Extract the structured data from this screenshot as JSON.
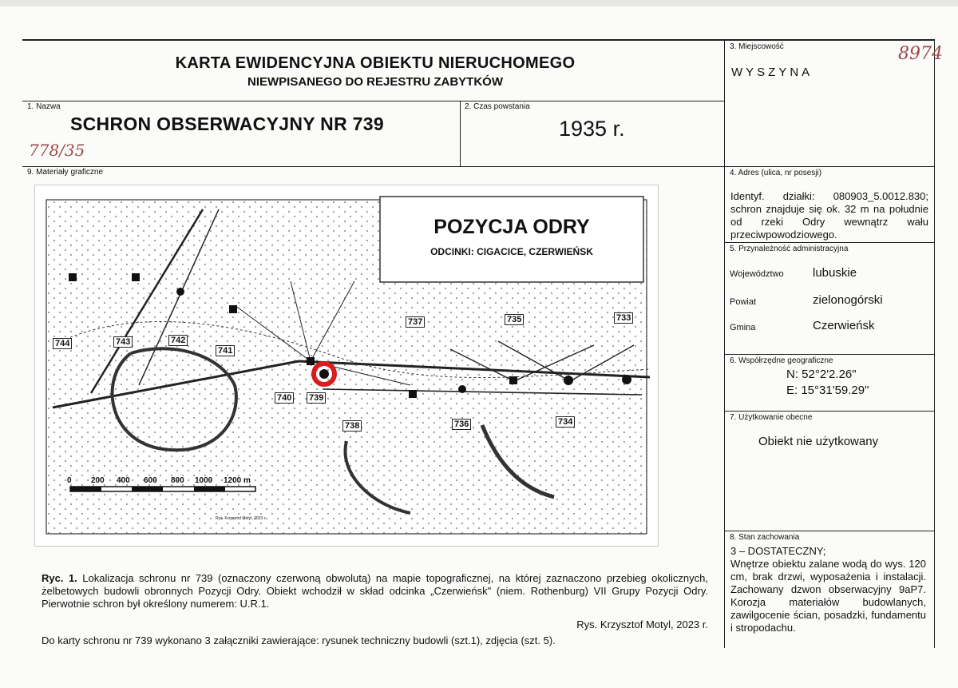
{
  "header": {
    "title_line1": "KARTA EWIDENCYJNA OBIEKTU NIERUCHOMEGO",
    "title_line2": "NIEWPISANEGO DO REJESTRU ZABYTKÓW"
  },
  "handwritten": {
    "top_right": "8974",
    "under_name": "778/35"
  },
  "fields": {
    "nazwa": {
      "label": "1. Nazwa",
      "value": "SCHRON OBSERWACYJNY NR 739"
    },
    "czas": {
      "label": "2. Czas powstania",
      "value": "1935 r."
    },
    "miejscowosc": {
      "label": "3. Miejscowość",
      "value": "WYSZYNA"
    },
    "adres": {
      "label": "4. Adres (ulica, nr posesji)",
      "value": "Identyf. działki: 080903_5.0012.830; schron znajduje się ok. 32 m na południe od rzeki Odry wewnątrz wału przeciwpowodziowego."
    },
    "przynaleznosc": {
      "label": "5. Przynależność administracyjna",
      "rows": [
        {
          "key": "Województwo",
          "value": "lubuskie"
        },
        {
          "key": "Powiat",
          "value": "zielonogórski"
        },
        {
          "key": "Gmina",
          "value": "Czerwieńsk"
        }
      ]
    },
    "wspolrzedne": {
      "label": "6. Współrzędne geograficzne",
      "n": "N: 52°2'2.26\"",
      "e": "E: 15°31'59.29\""
    },
    "uzytkowanie": {
      "label": "7. Użytkowanie obecne",
      "value": "Obiekt nie użytkowany"
    },
    "stan": {
      "label": "8. Stan zachowania",
      "value": "3 – DOSTATECZNY;",
      "desc": "Wnętrze obiektu zalane wodą do wys. 120 cm, brak drzwi, wyposażenia i instalacji. Zachowany dzwon obserwacyjny 9aP7. Korozja materiałów budowlanych, zawilgocenie ścian, posadzki, fundamentu i stropodachu."
    },
    "materialy": {
      "label": "9. Materiały graficzne"
    }
  },
  "map": {
    "title": "POZYCJA ODRY",
    "subtitle": "ODCINKI: CIGACICE, CZERWIEŃSK",
    "bunkers": [
      "744",
      "743",
      "742",
      "741",
      "740",
      "739",
      "738",
      "737",
      "736",
      "735",
      "734",
      "733"
    ],
    "scale_ticks": [
      "0",
      "200",
      "400",
      "600",
      "800",
      "1000",
      "1200 m"
    ],
    "credit": "Rys. Krzysztof Motyl, 2023 r."
  },
  "caption": {
    "label": "Ryc. 1.",
    "text": "Lokalizacja schronu nr 739 (oznaczony czerwoną obwolutą) na mapie topograficznej, na której zaznaczono przebieg okolicznych, żelbetowych budowli obronnych Pozycji Odry. Obiekt wchodził w skład odcinka „Czerwieńsk\" (niem. Rothenburg) VII Grupy Pozycji Odry. Pierwotnie schron był określony numerem: U.R.1.",
    "credit": "Rys. Krzysztof Motyl, 2023 r.",
    "footer": "Do karty schronu nr 739 wykonano 3 załączniki zawierające: rysunek techniczny budowli (szt.1), zdjęcia (szt. 5)."
  },
  "colors": {
    "highlight": "#d91c1c",
    "ink": "#111111",
    "hand": "#9b4a4a"
  }
}
